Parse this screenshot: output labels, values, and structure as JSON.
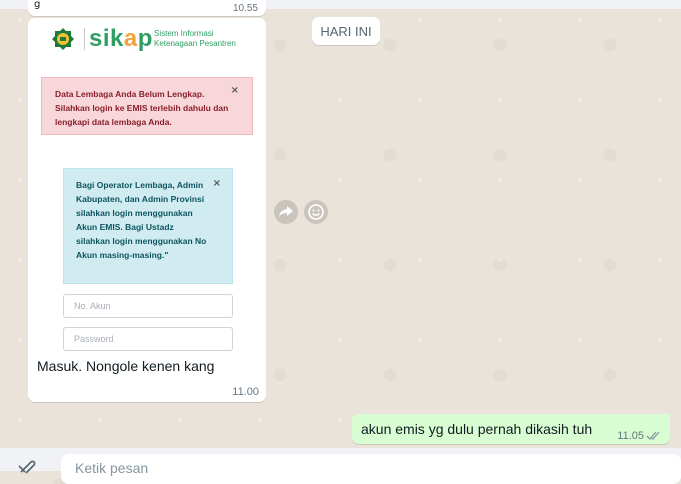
{
  "prev_message": {
    "partial_text": "g",
    "time": "10.55"
  },
  "day_divider": "HARI INI",
  "incoming_message": {
    "image": {
      "brand": {
        "name_part1": "sik",
        "name_dot": "a",
        "name_part2": "p",
        "tagline_line1": "Sistem Informasi",
        "tagline_line2": "Ketenagaan Pesantren"
      },
      "alert_red": {
        "text": "Data Lembaga Anda Belum Lengkap. Silahkan login ke EMIS terlebih dahulu dan lengkapi data lembaga Anda.",
        "close": "×"
      },
      "alert_blue": {
        "text": "Bagi Operator Lembaga, Admin Kabupaten, dan Admin Provinsi silahkan login menggunakan Akun EMIS. Bagi Ustadz silahkan login menggunakan No Akun masing-masing.\"",
        "close": "×"
      },
      "account_placeholder": "No. Akun",
      "password_placeholder": "Password"
    },
    "caption": "Masuk. Nongole kenen kang",
    "time": "11.00"
  },
  "outgoing_message": {
    "text": "akun emis yg dulu pernah dikasih tuh",
    "time": "11.05",
    "status": "read-double-check"
  },
  "composer": {
    "placeholder": "Ketik pesan"
  },
  "icons": [
    "emblem-icon",
    "forward-icon",
    "emoji-icon",
    "double-check-icon",
    "attach-icon"
  ],
  "colors": {
    "outgoing_bubble": "#d9fdd3",
    "brand_green": "#2f9e64",
    "alert_red_bg": "#f8d7da",
    "alert_blue_bg": "#d1ecf1"
  }
}
